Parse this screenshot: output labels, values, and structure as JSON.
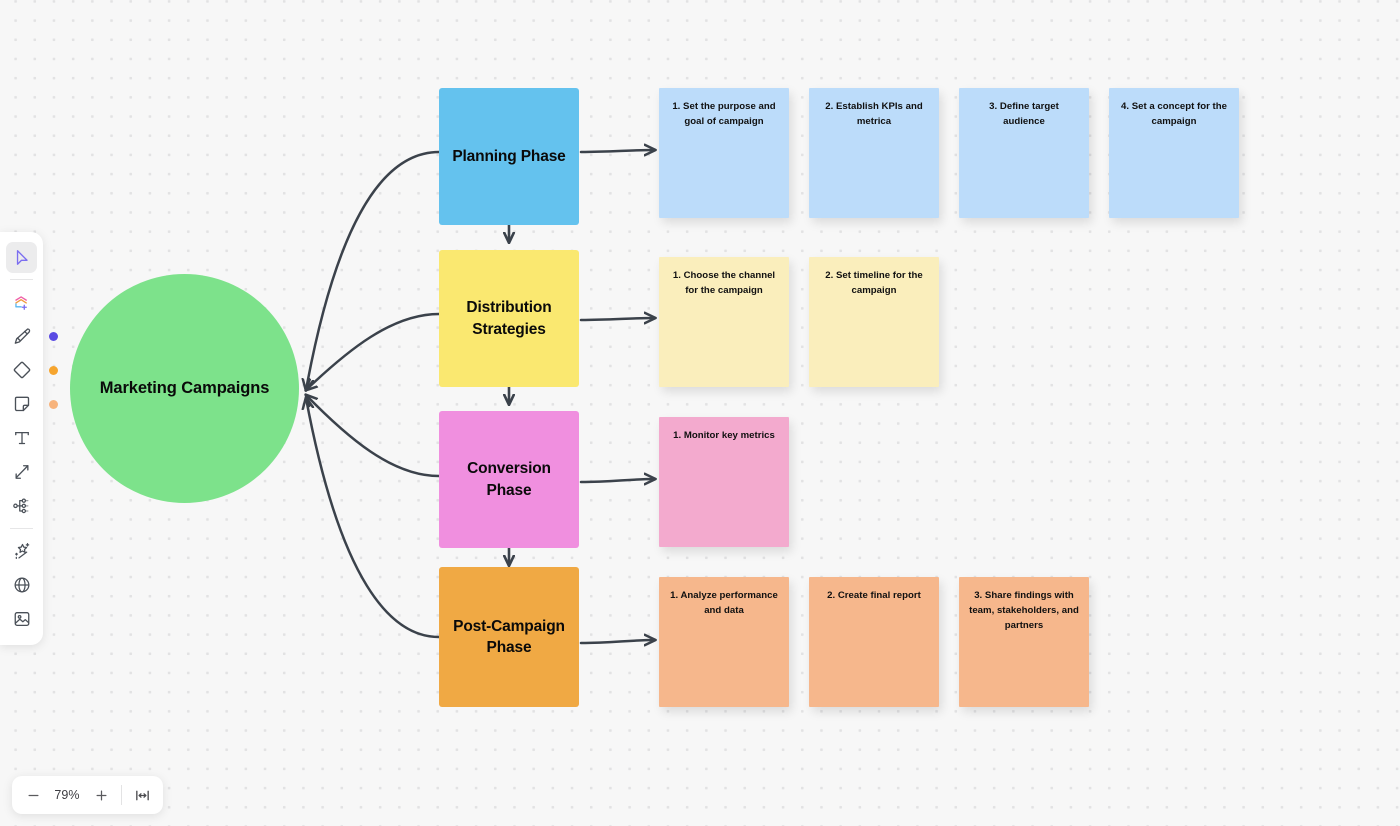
{
  "canvas": {
    "background_color": "#f7f7f7",
    "dot_color": "#e2e2e3"
  },
  "root": {
    "label": "Marketing Campaigns",
    "color": "#7de28b"
  },
  "phases": [
    {
      "id": "planning",
      "label": "Planning Phase",
      "color": "#64c2ee"
    },
    {
      "id": "distribution",
      "label": "Distribution Strategies",
      "color": "#fae870"
    },
    {
      "id": "conversion",
      "label": "Conversion Phase",
      "color": "#f08fdf"
    },
    {
      "id": "post-campaign",
      "label": "Post-Campaign Phase",
      "color": "#f0a944"
    }
  ],
  "notes": {
    "planning": {
      "color": "#bcdcfa",
      "items": [
        "1. Set the purpose and goal of campaign",
        "2.  Establish KPIs and metrica",
        "3. Define target audience",
        "4. Set a concept for the campaign"
      ]
    },
    "distribution": {
      "color": "#faeebc",
      "items": [
        "1. Choose the channel for the campaign",
        "2. Set timeline for the campaign"
      ]
    },
    "conversion": {
      "color": "#f3aace",
      "items": [
        "1. Monitor key metrics"
      ]
    },
    "post_campaign": {
      "color": "#f6b78c",
      "items": [
        "1. Analyze performance and data",
        "2. Create final report",
        "3. Share findings with team, stakeholders, and partners"
      ]
    }
  },
  "toolbar": {
    "tools": [
      {
        "name": "select-cursor-tool",
        "icon": "cursor-icon",
        "active": true,
        "dot": null
      },
      {
        "name": "templates-tool",
        "icon": "templates-icon",
        "active": false,
        "dot": null
      },
      {
        "name": "pen-tool",
        "icon": "pen-icon",
        "active": false,
        "dot": "#5a4ae3"
      },
      {
        "name": "shape-tool",
        "icon": "diamond-icon",
        "active": false,
        "dot": "#f6a52e"
      },
      {
        "name": "sticky-note-tool",
        "icon": "sticky-note-icon",
        "active": false,
        "dot": "#f7b37c"
      },
      {
        "name": "text-tool",
        "icon": "text-icon",
        "active": false,
        "dot": null
      },
      {
        "name": "connector-tool",
        "icon": "arrow-line-icon",
        "active": false,
        "dot": null
      },
      {
        "name": "mind-map-tool",
        "icon": "mind-map-icon",
        "active": false,
        "dot": null
      },
      {
        "name": "ai-tool",
        "icon": "magic-wand-icon",
        "active": false,
        "dot": null
      },
      {
        "name": "embed-tool",
        "icon": "globe-icon",
        "active": false,
        "dot": null
      },
      {
        "name": "image-tool",
        "icon": "image-icon",
        "active": false,
        "dot": null
      }
    ]
  },
  "zoom_bar": {
    "zoom_out_label": "−",
    "level": "79%",
    "zoom_in_label": "+",
    "fit_label": "fit-to-screen-icon"
  },
  "connector_color": "#3b424b"
}
